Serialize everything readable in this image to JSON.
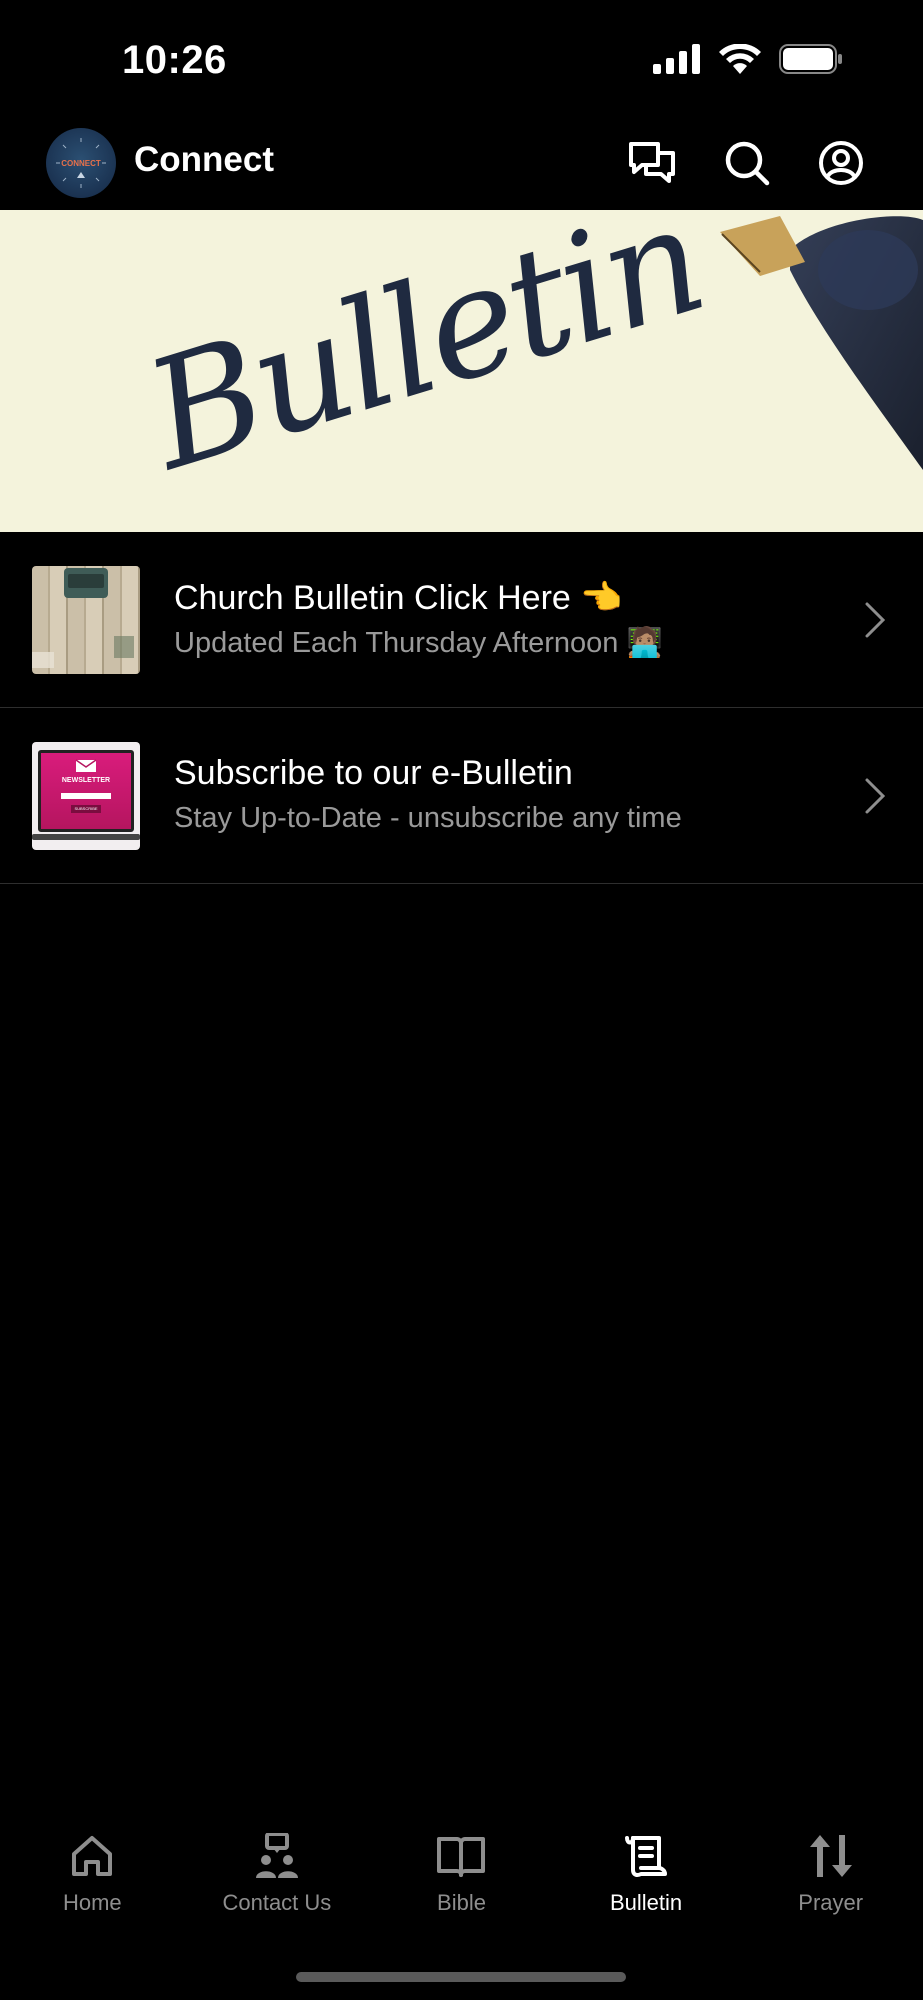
{
  "status": {
    "time": "10:26"
  },
  "header": {
    "title": "Connect",
    "logo_text": "CONNECT",
    "icons": [
      "chat-icon",
      "search-icon",
      "account-icon"
    ]
  },
  "banner": {
    "text": "Bulletin"
  },
  "list": [
    {
      "title": "Church Bulletin Click Here 👈",
      "subtitle": "Updated Each Thursday Afternoon 🧑🏽‍💻",
      "thumb": "typewriter-desk"
    },
    {
      "title": "Subscribe to our e-Bulletin",
      "subtitle": "Stay Up-to-Date - unsubscribe any time",
      "thumb": "newsletter-laptop",
      "thumb_label": "NEWSLETTER",
      "thumb_button": "SUBSCRIBE"
    }
  ],
  "tabs": [
    {
      "label": "Home",
      "icon": "home-icon",
      "active": false
    },
    {
      "label": "Contact Us",
      "icon": "contact-icon",
      "active": false
    },
    {
      "label": "Bible",
      "icon": "book-icon",
      "active": false
    },
    {
      "label": "Bulletin",
      "icon": "scroll-icon",
      "active": true
    },
    {
      "label": "Prayer",
      "icon": "prayer-arrows-icon",
      "active": false
    }
  ],
  "colors": {
    "background": "#000000",
    "banner_bg": "#f4f3dc",
    "ink": "#1f2a40",
    "subtitle": "#9a9a9a",
    "inactive_tab": "#8e8e8e"
  }
}
